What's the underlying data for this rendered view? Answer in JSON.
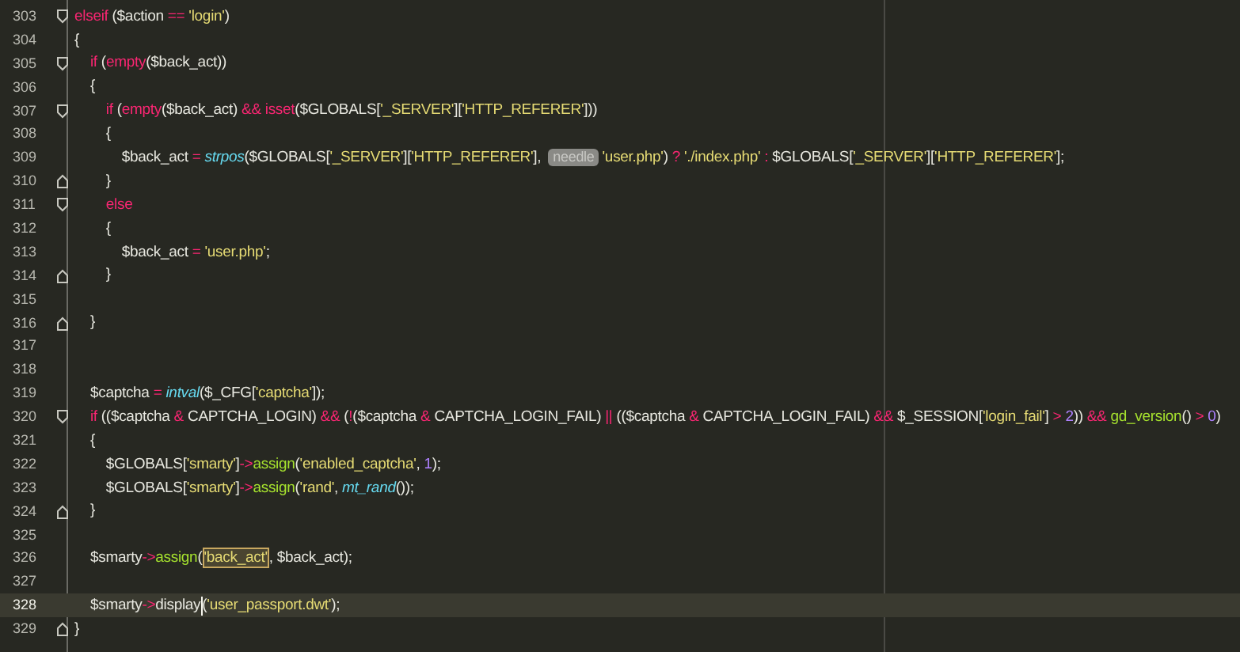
{
  "lines": [
    {
      "number": "303",
      "current": false,
      "fold_start": true,
      "fold_end": false,
      "tokens": [
        {
          "kind": "kw",
          "text": "elseif"
        },
        {
          "kind": "p",
          "text": " ("
        },
        {
          "kind": "var",
          "text": "$action"
        },
        {
          "kind": "op",
          "text": " == "
        },
        {
          "kind": "str",
          "text": "'login'"
        },
        {
          "kind": "p",
          "text": ")"
        }
      ]
    },
    {
      "number": "304",
      "current": false,
      "fold_start": false,
      "fold_end": false,
      "tokens": [
        {
          "kind": "p",
          "text": "{"
        }
      ]
    },
    {
      "number": "305",
      "current": false,
      "fold_start": true,
      "fold_end": false,
      "tokens": [
        {
          "kind": "kw",
          "text": "    if"
        },
        {
          "kind": "p",
          "text": " ("
        },
        {
          "kind": "kw",
          "text": "empty"
        },
        {
          "kind": "p",
          "text": "("
        },
        {
          "kind": "var",
          "text": "$back_act"
        },
        {
          "kind": "p",
          "text": "))"
        }
      ]
    },
    {
      "number": "306",
      "current": false,
      "fold_start": false,
      "fold_end": false,
      "tokens": [
        {
          "kind": "p",
          "text": "    {"
        }
      ]
    },
    {
      "number": "307",
      "current": false,
      "fold_start": true,
      "fold_end": false,
      "tokens": [
        {
          "kind": "kw",
          "text": "        if"
        },
        {
          "kind": "p",
          "text": " ("
        },
        {
          "kind": "kw",
          "text": "empty"
        },
        {
          "kind": "p",
          "text": "("
        },
        {
          "kind": "var",
          "text": "$back_act"
        },
        {
          "kind": "p",
          "text": ")"
        },
        {
          "kind": "op",
          "text": " && "
        },
        {
          "kind": "kw",
          "text": "isset"
        },
        {
          "kind": "p",
          "text": "("
        },
        {
          "kind": "var",
          "text": "$GLOBALS"
        },
        {
          "kind": "p",
          "text": "["
        },
        {
          "kind": "str",
          "text": "'_SERVER'"
        },
        {
          "kind": "p",
          "text": "]["
        },
        {
          "kind": "str",
          "text": "'HTTP_REFERER'"
        },
        {
          "kind": "p",
          "text": "]))"
        }
      ]
    },
    {
      "number": "308",
      "current": false,
      "fold_start": false,
      "fold_end": false,
      "tokens": [
        {
          "kind": "p",
          "text": "        {"
        }
      ]
    },
    {
      "number": "309",
      "current": false,
      "fold_start": false,
      "fold_end": false,
      "tokens": [
        {
          "kind": "var",
          "text": "            $back_act"
        },
        {
          "kind": "op",
          "text": " = "
        },
        {
          "kind": "fn",
          "text": "strpos"
        },
        {
          "kind": "p",
          "text": "("
        },
        {
          "kind": "var",
          "text": "$GLOBALS"
        },
        {
          "kind": "p",
          "text": "["
        },
        {
          "kind": "str",
          "text": "'_SERVER'"
        },
        {
          "kind": "p",
          "text": "]["
        },
        {
          "kind": "str",
          "text": "'HTTP_REFERER'"
        },
        {
          "kind": "p",
          "text": "], "
        },
        {
          "kind": "hint",
          "text": "needle"
        },
        {
          "kind": "str",
          "text": "'user.php'"
        },
        {
          "kind": "p",
          "text": ")"
        },
        {
          "kind": "op",
          "text": " ? "
        },
        {
          "kind": "str",
          "text": "'./index.php'"
        },
        {
          "kind": "op",
          "text": " : "
        },
        {
          "kind": "var",
          "text": "$GLOBALS"
        },
        {
          "kind": "p",
          "text": "["
        },
        {
          "kind": "str",
          "text": "'_SERVER'"
        },
        {
          "kind": "p",
          "text": "]["
        },
        {
          "kind": "str",
          "text": "'HTTP_REFERER'"
        },
        {
          "kind": "p",
          "text": "];"
        }
      ]
    },
    {
      "number": "310",
      "current": false,
      "fold_start": false,
      "fold_end": true,
      "tokens": [
        {
          "kind": "p",
          "text": "        }"
        }
      ]
    },
    {
      "number": "311",
      "current": false,
      "fold_start": true,
      "fold_end": false,
      "tokens": [
        {
          "kind": "kw",
          "text": "        else"
        }
      ]
    },
    {
      "number": "312",
      "current": false,
      "fold_start": false,
      "fold_end": false,
      "tokens": [
        {
          "kind": "p",
          "text": "        {"
        }
      ]
    },
    {
      "number": "313",
      "current": false,
      "fold_start": false,
      "fold_end": false,
      "tokens": [
        {
          "kind": "var",
          "text": "            $back_act"
        },
        {
          "kind": "op",
          "text": " = "
        },
        {
          "kind": "str",
          "text": "'user.php'"
        },
        {
          "kind": "p",
          "text": ";"
        }
      ]
    },
    {
      "number": "314",
      "current": false,
      "fold_start": false,
      "fold_end": true,
      "tokens": [
        {
          "kind": "p",
          "text": "        }"
        }
      ]
    },
    {
      "number": "315",
      "current": false,
      "fold_start": false,
      "fold_end": false
    },
    {
      "number": "316",
      "current": false,
      "fold_start": false,
      "fold_end": true,
      "tokens": [
        {
          "kind": "p",
          "text": "    }"
        }
      ]
    },
    {
      "number": "317",
      "current": false,
      "fold_start": false,
      "fold_end": false
    },
    {
      "number": "318",
      "current": false,
      "fold_start": false,
      "fold_end": false
    },
    {
      "number": "319",
      "current": false,
      "fold_start": false,
      "fold_end": false,
      "tokens": [
        {
          "kind": "var",
          "text": "    $captcha"
        },
        {
          "kind": "op",
          "text": " = "
        },
        {
          "kind": "fn",
          "text": "intval"
        },
        {
          "kind": "p",
          "text": "("
        },
        {
          "kind": "var",
          "text": "$_CFG"
        },
        {
          "kind": "p",
          "text": "["
        },
        {
          "kind": "str",
          "text": "'captcha'"
        },
        {
          "kind": "p",
          "text": "]);"
        }
      ]
    },
    {
      "number": "320",
      "current": false,
      "fold_start": true,
      "fold_end": false,
      "tokens": [
        {
          "kind": "kw",
          "text": "    if"
        },
        {
          "kind": "p",
          "text": " (("
        },
        {
          "kind": "var",
          "text": "$captcha"
        },
        {
          "kind": "op",
          "text": " & "
        },
        {
          "kind": "p",
          "text": "CAPTCHA_LOGIN)"
        },
        {
          "kind": "op",
          "text": " && "
        },
        {
          "kind": "p",
          "text": "("
        },
        {
          "kind": "op",
          "text": "!"
        },
        {
          "kind": "p",
          "text": "("
        },
        {
          "kind": "var",
          "text": "$captcha"
        },
        {
          "kind": "op",
          "text": " & "
        },
        {
          "kind": "p",
          "text": "CAPTCHA_LOGIN_FAIL)"
        },
        {
          "kind": "op",
          "text": " || "
        },
        {
          "kind": "p",
          "text": "(("
        },
        {
          "kind": "var",
          "text": "$captcha"
        },
        {
          "kind": "op",
          "text": " & "
        },
        {
          "kind": "p",
          "text": "CAPTCHA_LOGIN_FAIL)"
        },
        {
          "kind": "op",
          "text": " && "
        },
        {
          "kind": "var",
          "text": "$_SESSION"
        },
        {
          "kind": "p",
          "text": "["
        },
        {
          "kind": "str",
          "text": "'login_fail'"
        },
        {
          "kind": "p",
          "text": "]"
        },
        {
          "kind": "op",
          "text": " > "
        },
        {
          "kind": "num",
          "text": "2"
        },
        {
          "kind": "p",
          "text": "))"
        },
        {
          "kind": "op",
          "text": " && "
        },
        {
          "kind": "method",
          "text": "gd_version"
        },
        {
          "kind": "p",
          "text": "()"
        },
        {
          "kind": "op",
          "text": " > "
        },
        {
          "kind": "num",
          "text": "0"
        },
        {
          "kind": "p",
          "text": ")"
        }
      ]
    },
    {
      "number": "321",
      "current": false,
      "fold_start": false,
      "fold_end": false,
      "tokens": [
        {
          "kind": "p",
          "text": "    {"
        }
      ]
    },
    {
      "number": "322",
      "current": false,
      "fold_start": false,
      "fold_end": false,
      "tokens": [
        {
          "kind": "var",
          "text": "        $GLOBALS"
        },
        {
          "kind": "p",
          "text": "["
        },
        {
          "kind": "str",
          "text": "'smarty'"
        },
        {
          "kind": "p",
          "text": "]"
        },
        {
          "kind": "op",
          "text": "->"
        },
        {
          "kind": "method",
          "text": "assign"
        },
        {
          "kind": "p",
          "text": "("
        },
        {
          "kind": "str",
          "text": "'enabled_captcha'"
        },
        {
          "kind": "p",
          "text": ", "
        },
        {
          "kind": "num",
          "text": "1"
        },
        {
          "kind": "p",
          "text": ");"
        }
      ]
    },
    {
      "number": "323",
      "current": false,
      "fold_start": false,
      "fold_end": false,
      "tokens": [
        {
          "kind": "var",
          "text": "        $GLOBALS"
        },
        {
          "kind": "p",
          "text": "["
        },
        {
          "kind": "str",
          "text": "'smarty'"
        },
        {
          "kind": "p",
          "text": "]"
        },
        {
          "kind": "op",
          "text": "->"
        },
        {
          "kind": "method",
          "text": "assign"
        },
        {
          "kind": "p",
          "text": "("
        },
        {
          "kind": "str",
          "text": "'rand'"
        },
        {
          "kind": "p",
          "text": ", "
        },
        {
          "kind": "fn",
          "text": "mt_rand"
        },
        {
          "kind": "p",
          "text": "());"
        }
      ]
    },
    {
      "number": "324",
      "current": false,
      "fold_start": false,
      "fold_end": true,
      "tokens": [
        {
          "kind": "p",
          "text": "    }"
        }
      ]
    },
    {
      "number": "325",
      "current": false,
      "fold_start": false,
      "fold_end": false
    },
    {
      "number": "326",
      "current": false,
      "fold_start": false,
      "fold_end": false,
      "tokens": [
        {
          "kind": "var",
          "text": "    $smarty"
        },
        {
          "kind": "op",
          "text": "->"
        },
        {
          "kind": "method",
          "text": "assign"
        },
        {
          "kind": "p",
          "text": "("
        },
        {
          "kind": "match",
          "text": "'back_act'"
        },
        {
          "kind": "p",
          "text": ", "
        },
        {
          "kind": "var",
          "text": "$back_act"
        },
        {
          "kind": "p",
          "text": ");"
        }
      ]
    },
    {
      "number": "327",
      "current": false,
      "fold_start": false,
      "fold_end": false
    },
    {
      "number": "328",
      "current": true,
      "fold_start": false,
      "fold_end": false,
      "tokens": [
        {
          "kind": "var",
          "text": "    $smarty"
        },
        {
          "kind": "op",
          "text": "->"
        },
        {
          "kind": "p",
          "text": "display"
        },
        {
          "kind": "caret"
        },
        {
          "kind": "p",
          "text": "("
        },
        {
          "kind": "str",
          "text": "'user_passport.dwt'"
        },
        {
          "kind": "p",
          "text": ");"
        }
      ]
    },
    {
      "number": "329",
      "current": false,
      "fold_start": false,
      "fold_end": true,
      "tokens": [
        {
          "kind": "p",
          "text": "}"
        }
      ]
    }
  ]
}
